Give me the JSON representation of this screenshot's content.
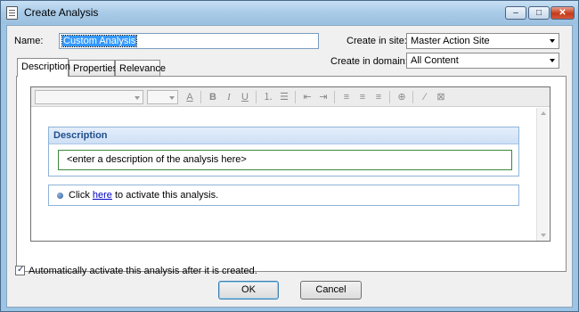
{
  "window": {
    "title": "Create Analysis",
    "min_glyph": "–",
    "max_glyph": "□",
    "close_glyph": "✕"
  },
  "form": {
    "name_label": "Name:",
    "name_value": "Custom Analysis",
    "site_label": "Create in site:",
    "site_value": "Master Action Site",
    "domain_label": "Create in domain:",
    "domain_value": "All Content"
  },
  "tabs": [
    {
      "label": "Description"
    },
    {
      "label": "Properties"
    },
    {
      "label": "Relevance"
    }
  ],
  "toolbar": {
    "icons": [
      "font-color-icon",
      "bold-icon",
      "italic-icon",
      "underline-icon",
      "ordered-list-icon",
      "unordered-list-icon",
      "outdent-icon",
      "indent-icon",
      "align-left-icon",
      "align-center-icon",
      "align-right-icon",
      "insert-link-icon",
      "magic-wand-icon",
      "clear-format-icon"
    ],
    "glyphs": {
      "font_color": "A",
      "bold": "B",
      "italic": "I",
      "underline": "U",
      "ordered": "⒈",
      "unordered": "☰",
      "outdent": "⇤",
      "indent": "⇥",
      "align_left": "≡",
      "align_center": "≡",
      "align_right": "≡",
      "link": "⊕",
      "wand": "⁄",
      "clear": "⊠"
    }
  },
  "editor": {
    "description_header": "Description",
    "description_placeholder": "<enter a description of the analysis here>",
    "activate_prefix": "Click ",
    "activate_link": "here",
    "activate_suffix": " to activate this analysis."
  },
  "footer": {
    "auto_activate_label": "Automatically activate this analysis after it is created.",
    "auto_activate_checked": true,
    "ok_label": "OK",
    "cancel_label": "Cancel"
  },
  "colors": {
    "accent": "#3399ff",
    "link": "#0000cc",
    "panel_header": "#1f4e8c",
    "field_border": "#3b8a3b"
  }
}
